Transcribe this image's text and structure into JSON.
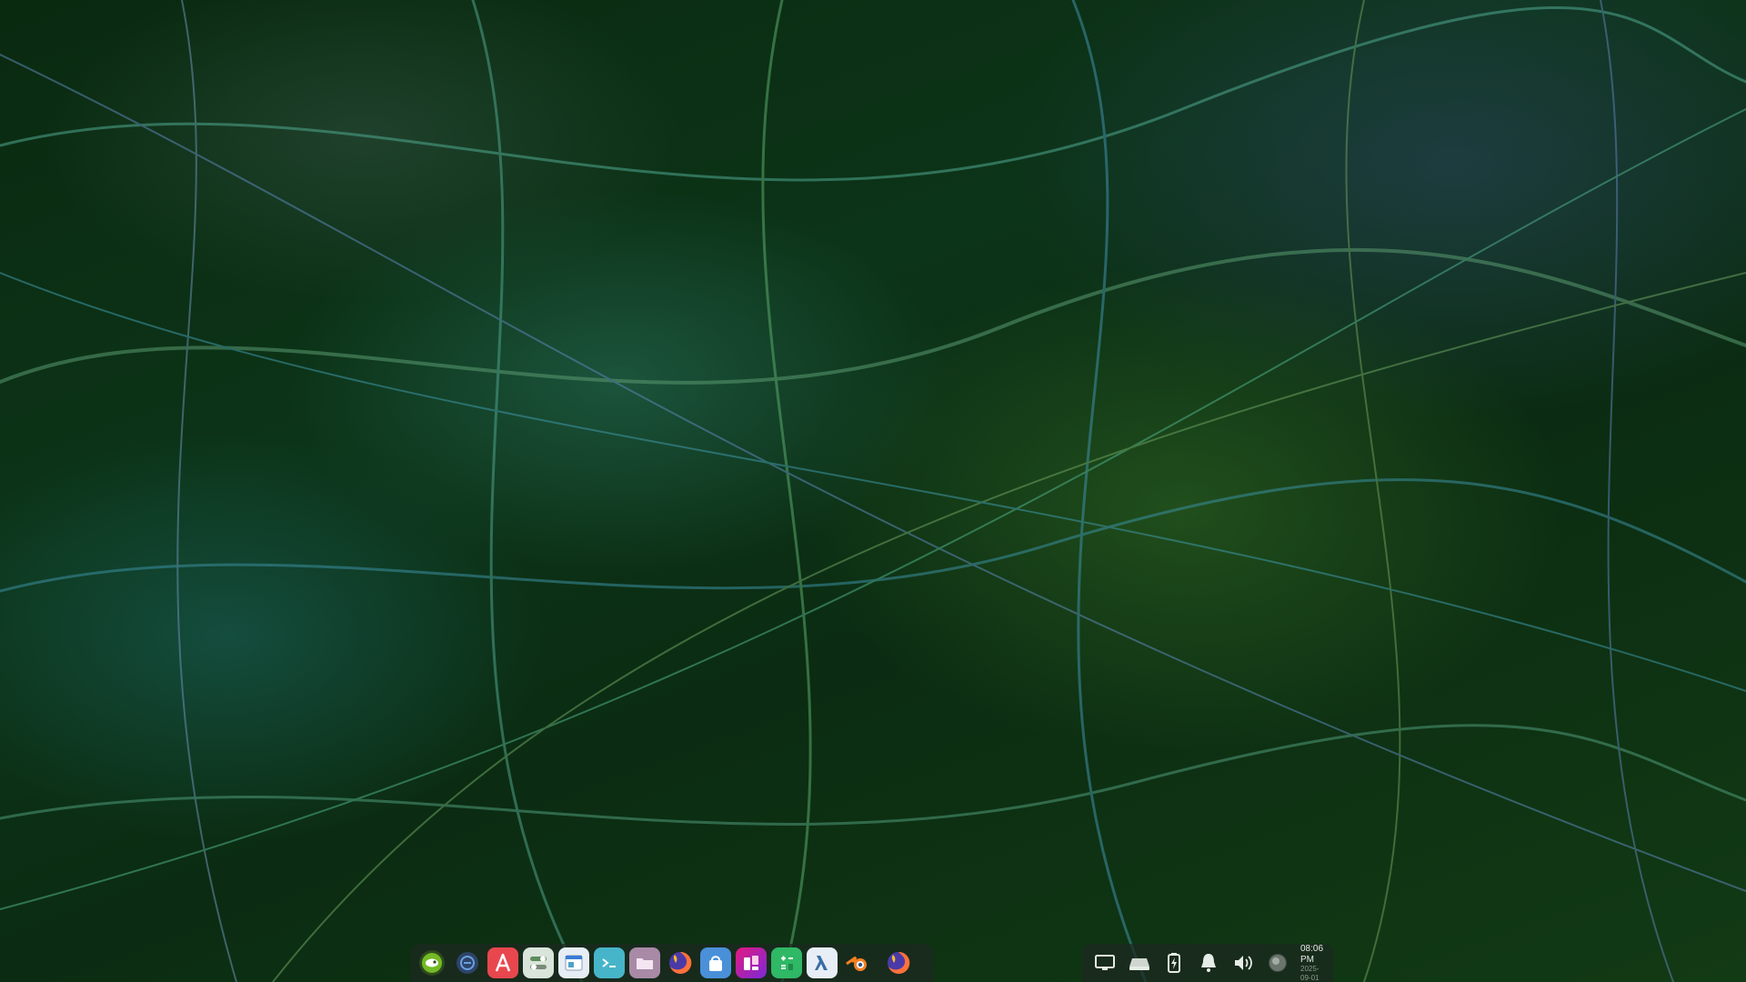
{
  "desktop": {
    "wallpaper": "abstract-green-light-streaks"
  },
  "dock": {
    "apps": [
      {
        "name": "opensuse-menu",
        "icon": "opensuse-gecko-icon",
        "color": "#73ba25"
      },
      {
        "name": "workspace-overview",
        "icon": "circle-minus-icon",
        "color": "#3a6ea5"
      },
      {
        "name": "app-center",
        "icon": "letter-a-icon",
        "color": "#e8474e"
      },
      {
        "name": "settings",
        "icon": "toggles-icon",
        "color": "#d9e4da"
      },
      {
        "name": "system-monitor",
        "icon": "window-icon",
        "color": "#e7edf5"
      },
      {
        "name": "terminal",
        "icon": "terminal-icon",
        "color": "#47b5c9"
      },
      {
        "name": "files",
        "icon": "folder-icon",
        "color": "#a88aa6"
      },
      {
        "name": "firefox",
        "icon": "firefox-icon",
        "color": "#ff7139"
      },
      {
        "name": "store",
        "icon": "bag-icon",
        "color": "#4a90d9"
      },
      {
        "name": "kdenlive",
        "icon": "clapper-icon",
        "color": "#e4197f"
      },
      {
        "name": "calculator",
        "icon": "calculator-icon",
        "color": "#2fb865"
      },
      {
        "name": "inkscape",
        "icon": "lambda-icon",
        "color": "#5d8fd6"
      },
      {
        "name": "blender",
        "icon": "blender-icon",
        "color": "#f58021"
      },
      {
        "name": "firefox-running",
        "icon": "firefox-icon",
        "color": "#ff7139"
      }
    ]
  },
  "tray": {
    "items": [
      {
        "name": "display",
        "icon": "monitor-icon"
      },
      {
        "name": "removable-drive",
        "icon": "drive-icon"
      },
      {
        "name": "battery",
        "icon": "battery-charging-icon"
      },
      {
        "name": "notifications",
        "icon": "bell-icon"
      },
      {
        "name": "volume",
        "icon": "speaker-icon"
      },
      {
        "name": "user",
        "icon": "avatar-icon"
      }
    ],
    "clock": {
      "time": "08:06 PM",
      "date": "2025-09-01"
    }
  }
}
